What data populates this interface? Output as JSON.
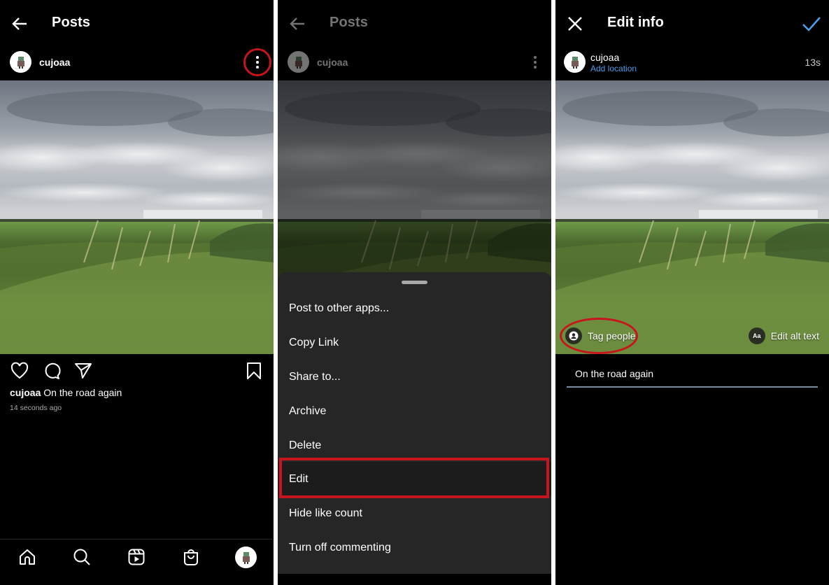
{
  "panel1": {
    "header": {
      "title": "Posts",
      "back_icon": "arrow-left-icon"
    },
    "post": {
      "username": "cujoaa",
      "more_icon": "more-vertical-icon",
      "actions": [
        "heart-icon",
        "comment-icon",
        "send-icon",
        "bookmark-icon"
      ],
      "caption_user": "cujoaa",
      "caption_text": "On the road again",
      "timestamp": "14 seconds ago"
    },
    "bottom_nav": [
      "home-icon",
      "search-icon",
      "reels-icon",
      "shop-icon",
      "profile-avatar"
    ],
    "annotation_color": "#c4161c"
  },
  "panel2": {
    "header": {
      "title": "Posts"
    },
    "post": {
      "username": "cujoaa"
    },
    "sheet": {
      "items": [
        {
          "label": "Post to other apps..."
        },
        {
          "label": "Copy Link"
        },
        {
          "label": "Share to..."
        },
        {
          "label": "Archive"
        },
        {
          "label": "Delete"
        },
        {
          "label": "Edit",
          "highlighted": true
        },
        {
          "label": "Hide like count"
        },
        {
          "label": "Turn off commenting"
        }
      ]
    }
  },
  "panel3": {
    "header": {
      "title": "Edit info",
      "close_icon": "close-icon",
      "confirm_icon": "check-icon"
    },
    "post": {
      "username": "cujoaa",
      "location_link": "Add location",
      "age": "13s"
    },
    "tag_people": "Tag people",
    "alt_text_chip": "Aa",
    "edit_alt_text": "Edit alt text",
    "caption_value": "On the road again",
    "accent_color": "#4a9eea"
  }
}
